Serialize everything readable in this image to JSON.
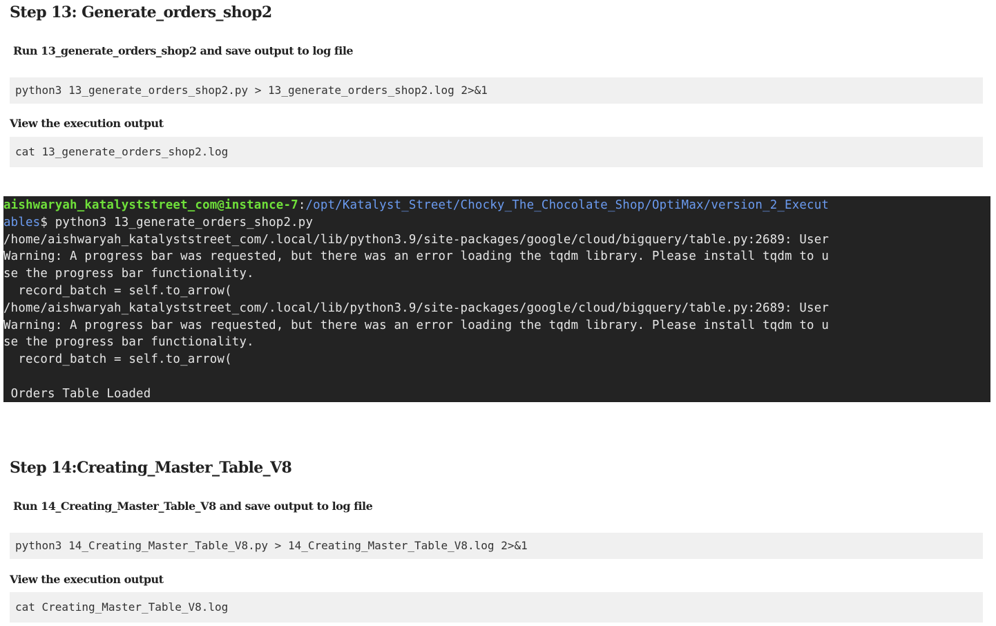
{
  "step13": {
    "title": "Step 13: Generate_orders_shop2",
    "run_label": "Run 13_generate_orders_shop2 and save output to log file",
    "run_command": "python3 13_generate_orders_shop2.py > 13_generate_orders_shop2.log 2>&1",
    "view_label": "View the execution output",
    "view_command": "cat 13_generate_orders_shop2.log"
  },
  "terminal": {
    "prompt_user": "aishwaryah_katalyststreet_com@instance-7",
    "prompt_sep": ":",
    "prompt_path_a": "/opt/Katalyst_Street/Chocky_The_Chocolate_Shop/OptiMax/version_2_Execut",
    "prompt_path_b": "ables",
    "prompt_cmd": "$ python3 13_generate_orders_shop2.py",
    "lines": [
      "/home/aishwaryah_katalyststreet_com/.local/lib/python3.9/site-packages/google/cloud/bigquery/table.py:2689: User",
      "Warning: A progress bar was requested, but there was an error loading the tqdm library. Please install tqdm to u",
      "se the progress bar functionality.",
      "  record_batch = self.to_arrow(",
      "/home/aishwaryah_katalyststreet_com/.local/lib/python3.9/site-packages/google/cloud/bigquery/table.py:2689: User",
      "Warning: A progress bar was requested, but there was an error loading the tqdm library. Please install tqdm to u",
      "se the progress bar functionality.",
      "  record_batch = self.to_arrow(",
      "",
      " Orders Table Loaded"
    ],
    "colors": {
      "background": "#232323",
      "user": "#6fe03a",
      "path": "#6b9bf0",
      "text": "#e6e6e6"
    }
  },
  "step14": {
    "title": "Step 14:Creating_Master_Table_V8",
    "run_label": "Run 14_Creating_Master_Table_V8 and save output to log file",
    "run_command": "python3 14_Creating_Master_Table_V8.py > 14_Creating_Master_Table_V8.log 2>&1",
    "view_label": "View the execution output",
    "view_command": "cat Creating_Master_Table_V8.log"
  }
}
